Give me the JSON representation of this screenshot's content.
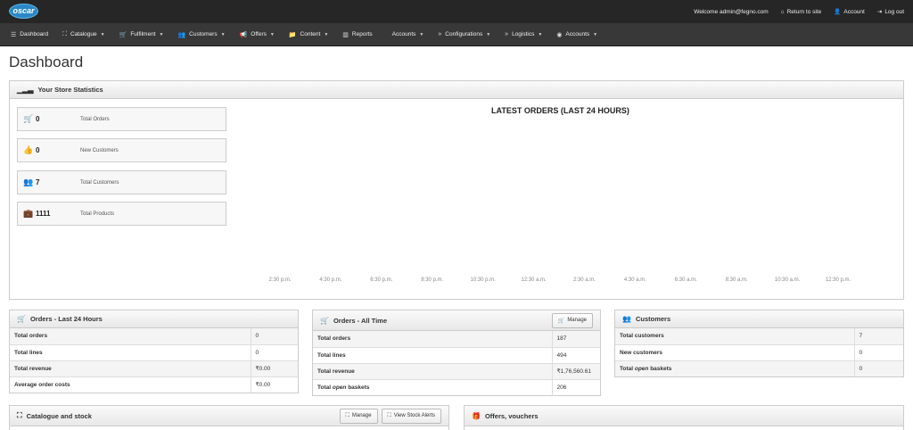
{
  "brand": {
    "logo_text": "oscar"
  },
  "user_links": {
    "welcome": "Welcome admin@fegno.com",
    "return": "Return to site",
    "account": "Account",
    "logout": "Log out"
  },
  "nav": [
    {
      "label": "Dashboard",
      "icon": "list-icon",
      "caret": false
    },
    {
      "label": "Catalogue",
      "icon": "sitemap-icon",
      "caret": true
    },
    {
      "label": "Fulfilment",
      "icon": "cart-icon",
      "caret": true
    },
    {
      "label": "Customers",
      "icon": "users-icon",
      "caret": true
    },
    {
      "label": "Offers",
      "icon": "bullhorn-icon",
      "caret": true
    },
    {
      "label": "Content",
      "icon": "folder-icon",
      "caret": true
    },
    {
      "label": "Reports",
      "icon": "bar-chart-icon",
      "caret": false
    },
    {
      "label": "Accounts",
      "icon": "",
      "caret": true
    },
    {
      "label": "Configurations",
      "icon": "chevron-icon",
      "caret": true
    },
    {
      "label": "Logistics",
      "icon": "chevron-icon",
      "caret": true
    },
    {
      "label": "Accounts",
      "icon": "globe-icon",
      "caret": true
    }
  ],
  "page_title": "Dashboard",
  "stats_panel": {
    "title": "Your Store Statistics",
    "items": [
      {
        "value": "0",
        "label": "Total Orders",
        "icon": "cart-icon"
      },
      {
        "value": "0",
        "label": "New Customers",
        "icon": "thumbs-up-icon"
      },
      {
        "value": "7",
        "label": "Total Customers",
        "icon": "users-icon"
      },
      {
        "value": "1111",
        "label": "Total Products",
        "icon": "briefcase-icon"
      }
    ],
    "chart": {
      "title": "LATEST ORDERS (LAST 24 HOURS)",
      "x_labels": [
        "2:30 p.m.",
        "4:30 p.m.",
        "6:30 p.m.",
        "8:30 p.m.",
        "10:30 p.m.",
        "12:30 a.m.",
        "2:30 a.m.",
        "4:30 a.m.",
        "6:30 a.m.",
        "8:30 a.m.",
        "10:30 a.m.",
        "12:30 p.m."
      ]
    }
  },
  "orders_24h": {
    "title": "Orders - Last 24 Hours",
    "rows": [
      {
        "label": "Total orders",
        "value": "0"
      },
      {
        "label": "Total lines",
        "value": "0"
      },
      {
        "label": "Total revenue",
        "value": "₹0.00"
      },
      {
        "label": "Average order costs",
        "value": "₹0.00"
      }
    ]
  },
  "orders_all": {
    "title": "Orders - All Time",
    "manage": "Manage",
    "rows": [
      {
        "label": "Total orders",
        "value": "187"
      },
      {
        "label": "Total lines",
        "value": "494"
      },
      {
        "label": "Total revenue",
        "value": "₹1,76,560.61"
      },
      {
        "label_pre": "Total ",
        "label_em": "open",
        "label_post": " baskets",
        "value": "206"
      }
    ]
  },
  "customers": {
    "title": "Customers",
    "rows": [
      {
        "label": "Total customers",
        "value": "7"
      },
      {
        "label": "New customers",
        "value": "0"
      },
      {
        "label_pre": "Total ",
        "label_em": "open",
        "label_post": " baskets",
        "value": "0"
      }
    ]
  },
  "catalogue": {
    "title": "Catalogue and stock",
    "manage": "Manage",
    "alerts": "View Stock Alerts"
  },
  "offers": {
    "title": "Offers, vouchers"
  }
}
